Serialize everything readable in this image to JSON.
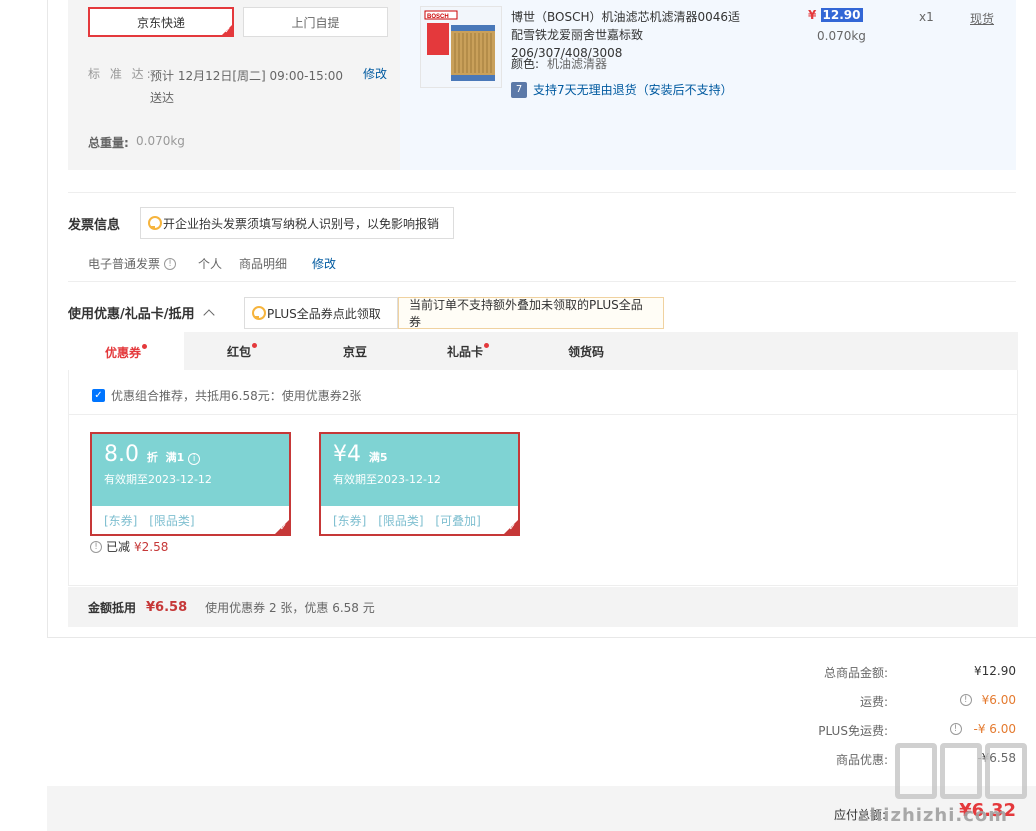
{
  "shipping": {
    "jd_express_label": "京东快递",
    "self_pickup_label": "上门自提",
    "standard_label": "标 准 达:",
    "standard_text": "预计 12月12日[周二] 09:00-15:00 送达",
    "edit_label": "修改",
    "total_weight_label": "总重量:",
    "total_weight_value": "0.070kg"
  },
  "product": {
    "title": "博世（BOSCH）机油滤芯机滤清器0046适配雪铁龙爱丽舍世嘉标致206/307/408/3008",
    "color_label": "颜色:",
    "color_value": "机油滤清器",
    "return_text": "支持7天无理由退货（安装后不支持）",
    "price_symbol": "¥",
    "price": "12.90",
    "weight": "0.070kg",
    "qty": "x1",
    "stock": "现货",
    "image_brand": "BOSCH"
  },
  "invoice": {
    "title": "发票信息",
    "tip": "开企业抬头发票须填写纳税人识别号，以免影响报销",
    "type": "电子普通发票",
    "person": "个人",
    "detail": "商品明细",
    "edit_label": "修改"
  },
  "coupons": {
    "title": "使用优惠/礼品卡/抵用",
    "plus_tip": "PLUS全品券点此领取",
    "plus_notice": "当前订单不支持额外叠加未领取的PLUS全品券",
    "tabs": [
      {
        "label": "优惠券",
        "dot": true
      },
      {
        "label": "红包",
        "dot": true
      },
      {
        "label": "京豆",
        "dot": false
      },
      {
        "label": "礼品卡",
        "dot": true
      },
      {
        "label": "领货码",
        "dot": false
      }
    ],
    "combo_text": "优惠组合推荐，共抵用6.58元：使用优惠券2张",
    "items": [
      {
        "value": "8.0",
        "unit": "折",
        "cond": "满1",
        "valid": "有效期至2023-12-12",
        "tags": [
          "[东券]",
          "[限品类]"
        ]
      },
      {
        "value": "¥4",
        "unit": "满5",
        "cond": "",
        "valid": "有效期至2023-12-12",
        "tags": [
          "[东券]",
          "[限品类]",
          "[可叠加]"
        ]
      }
    ],
    "deducted_label": "已减",
    "deducted_value": "¥2.58",
    "summary_label": "金额抵用",
    "summary_value": "¥6.58",
    "summary_desc": "使用优惠券 2 张，优惠 6.58 元"
  },
  "totals": {
    "goods_label": "总商品金额:",
    "goods_value": "¥12.90",
    "freight_label": "运费:",
    "freight_value": "¥6.00",
    "plus_freight_label": "PLUS免运费:",
    "plus_freight_value": "-¥ 6.00",
    "discount_label": "商品优惠:",
    "discount_value": "-¥6.58",
    "payable_label": "应付总额:",
    "payable_value": "¥6.32"
  },
  "watermark": {
    "text": "zhizhizhi.com"
  },
  "colors": {
    "accent": "#e4393c",
    "link": "#005aa0",
    "coupon": "#7fd3d3"
  }
}
